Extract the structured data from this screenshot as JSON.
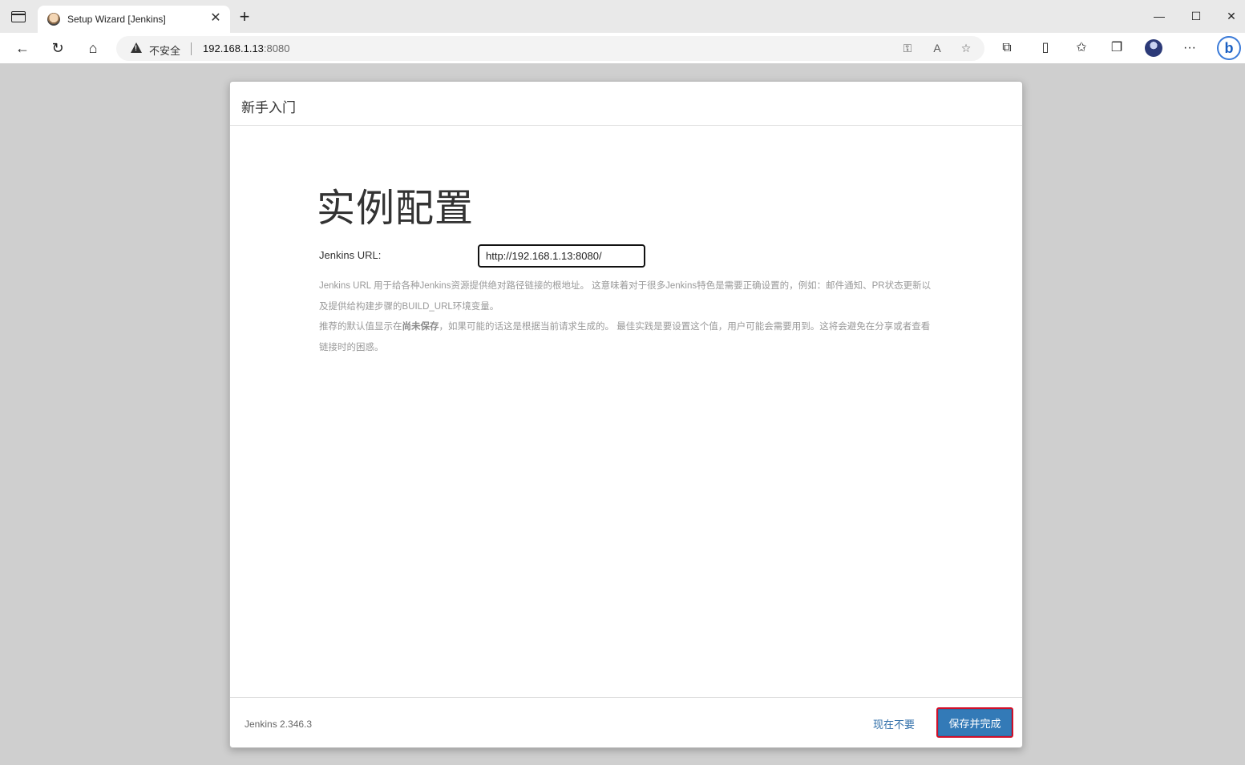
{
  "browser": {
    "tab_title": "Setup Wizard [Jenkins]",
    "tab_close": "✕",
    "new_tab": "+",
    "window_controls": {
      "minimize": "—",
      "maximize": "☐",
      "close": "✕"
    },
    "nav": {
      "back": "←",
      "reload": "↻",
      "home": "⌂"
    },
    "address": {
      "security_label": "不安全",
      "host": "192.168.1.13",
      "port": ":8080"
    },
    "toolbar_icons": [
      "key-icon",
      "read-aloud-icon",
      "add-favorite-icon",
      "extensions-icon",
      "split-screen-icon",
      "favorites-icon",
      "collections-icon",
      "profile-avatar",
      "more-menu-icon",
      "bing-copilot-icon"
    ],
    "bing_label": "b",
    "more_label": "···"
  },
  "dialog": {
    "header_title": "新手入门",
    "heading": "实例配置",
    "url_field": {
      "label": "Jenkins URL:",
      "value": "http://192.168.1.13:8080/"
    },
    "help": {
      "line1": "Jenkins URL 用于给各种Jenkins资源提供绝对路径链接的根地址。 这意味着对于很多Jenkins特色是需要正确设置的，例如：邮件通知、PR状态更新以及提供给构建步骤的BUILD_URL环境变量。",
      "line2_prefix": "推荐的默认值显示在",
      "line2_bold": "尚未保存",
      "line2_suffix": "，如果可能的话这是根据当前请求生成的。 最佳实践是要设置这个值，用户可能会需要用到。这将会避免在分享或者查看链接时的困惑。"
    },
    "footer": {
      "version": "Jenkins 2.346.3",
      "skip_label": "现在不要",
      "save_label": "保存并完成"
    }
  }
}
